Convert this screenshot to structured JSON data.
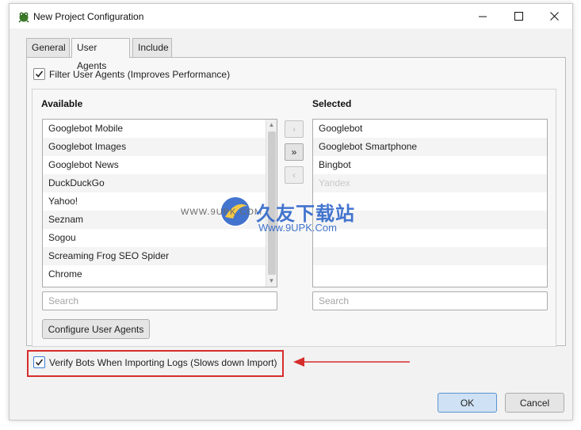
{
  "window": {
    "title": "New Project Configuration",
    "minimize_glyph": "—",
    "maximize_glyph": "☐",
    "close_glyph": "✕"
  },
  "tabs": [
    {
      "label": "General",
      "active": false
    },
    {
      "label": "User Agents",
      "active": true
    },
    {
      "label": "Include",
      "active": false
    }
  ],
  "filter": {
    "label": "Filter User Agents (Improves Performance)",
    "checked": true
  },
  "available": {
    "title": "Available",
    "items": [
      "Googlebot Mobile",
      "Googlebot Images",
      "Googlebot News",
      "DuckDuckGo",
      "Yahoo!",
      "Seznam",
      "Sogou",
      "Screaming Frog SEO Spider",
      "Chrome"
    ],
    "search_placeholder": "Search"
  },
  "selected": {
    "title": "Selected",
    "items": [
      "Googlebot",
      "Googlebot Smartphone",
      "Bingbot",
      "Yandex"
    ],
    "search_placeholder": "Search"
  },
  "move_buttons": {
    "right_one": "›",
    "right_all": "»",
    "left_one": "‹",
    "left_all": "«"
  },
  "configure_button": "Configure User Agents",
  "verify": {
    "label": "Verify Bots When Importing Logs (Slows down Import)",
    "checked": true
  },
  "buttons": {
    "ok": "OK",
    "cancel": "Cancel"
  },
  "watermark": {
    "left_url": "WWW.9UPK.COM",
    "brand": "久友下载站",
    "url": "Www.9UPK.Com"
  },
  "colors": {
    "highlight": "#d62d2d",
    "ok_button": "#cfe1f4",
    "watermark_blue": "#2a62c9"
  }
}
